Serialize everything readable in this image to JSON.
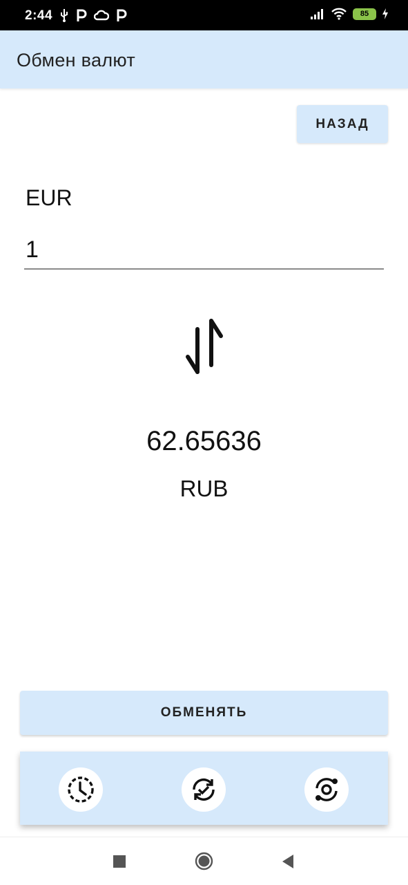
{
  "status_bar": {
    "time": "2:44",
    "battery_level": "85",
    "icons_left": [
      "usb-icon",
      "p-app-icon",
      "cloud-icon",
      "p-app-icon"
    ],
    "icons_right": [
      "signal-icon",
      "wifi-icon",
      "battery-icon",
      "charging-icon"
    ]
  },
  "app_bar": {
    "title": "Обмен валют",
    "background": "#d6e9fb"
  },
  "back_button": {
    "label": "НАЗАД"
  },
  "converter": {
    "from_currency": "EUR",
    "amount": "1",
    "swap_icon": "swap-vertical-icon",
    "result": "62.65636",
    "to_currency": "RUB"
  },
  "exchange_button": {
    "label": "ОБМЕНЯТЬ"
  },
  "bottom_nav": {
    "items": [
      {
        "icon": "history-icon"
      },
      {
        "icon": "exchange-icon"
      },
      {
        "icon": "currency-rates-icon"
      }
    ]
  },
  "system_nav": {
    "items": [
      "recents-icon",
      "home-icon",
      "back-icon"
    ]
  }
}
